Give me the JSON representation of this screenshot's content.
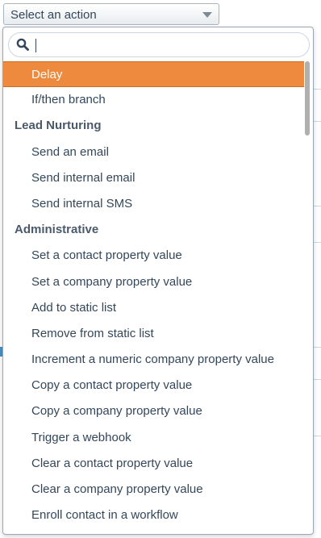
{
  "select": {
    "value": "Select an action",
    "caret_icon": "chevron-down-icon"
  },
  "search": {
    "value": "",
    "placeholder": "",
    "icon": "search-icon"
  },
  "list": {
    "ungrouped": [
      {
        "label": "Delay",
        "highlighted": true
      },
      {
        "label": "If/then branch"
      }
    ],
    "groups": [
      {
        "title": "Lead Nurturing",
        "items": [
          {
            "label": "Send an email"
          },
          {
            "label": "Send internal email"
          },
          {
            "label": "Send internal SMS"
          }
        ]
      },
      {
        "title": "Administrative",
        "items": [
          {
            "label": "Set a contact property value"
          },
          {
            "label": "Set a company property value"
          },
          {
            "label": "Add to static list"
          },
          {
            "label": "Remove from static list"
          },
          {
            "label": "Increment a numeric company property value"
          },
          {
            "label": "Copy a contact property value"
          },
          {
            "label": "Copy a company property value"
          },
          {
            "label": "Trigger a webhook"
          },
          {
            "label": "Clear a contact property value"
          },
          {
            "label": "Clear a company property value"
          },
          {
            "label": "Enroll contact in a workflow"
          }
        ]
      }
    ]
  },
  "colors": {
    "highlight": "#ee8a3e",
    "text": "#33475b",
    "border": "#9aa8b5"
  }
}
